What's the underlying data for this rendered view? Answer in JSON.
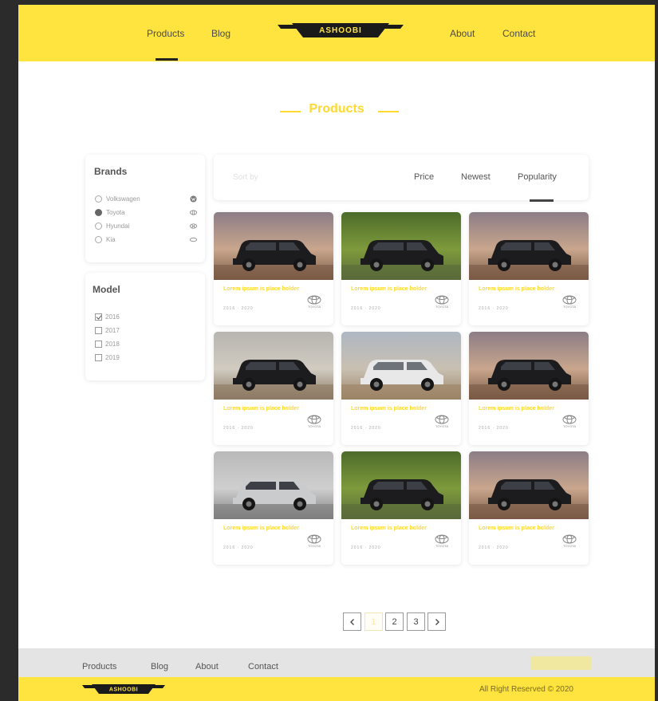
{
  "nav": {
    "left": [
      "Products",
      "Blog"
    ],
    "right": [
      "About",
      "Contact"
    ],
    "logo_text": "ASHOOBI"
  },
  "section_title": "Products",
  "filters": {
    "brands_title": "Brands",
    "brands": [
      {
        "label": "Volkswagen",
        "checked": false,
        "icon": "vw-logo-icon"
      },
      {
        "label": "Toyota",
        "checked": true,
        "icon": "toyota-logo-icon"
      },
      {
        "label": "Hyundai",
        "checked": false,
        "icon": "hyundai-logo-icon"
      },
      {
        "label": "Kia",
        "checked": false,
        "icon": "kia-logo-icon"
      }
    ],
    "model_title": "Model",
    "models": [
      {
        "label": "2016",
        "checked": true
      },
      {
        "label": "2017",
        "checked": false
      },
      {
        "label": "2018",
        "checked": false
      },
      {
        "label": "2019",
        "checked": false
      }
    ]
  },
  "sort": {
    "placeholder": "Sort by",
    "options": [
      "Price",
      "Newest",
      "Popularity"
    ],
    "active": "Popularity"
  },
  "products": [
    {
      "name": "Lorem ipsum is place holder",
      "meta": "2016 · 2020",
      "brand": "TOYOTA",
      "scene": "dusk",
      "car": "black"
    },
    {
      "name": "Lorem ipsum is place holder",
      "meta": "2016 · 2020",
      "brand": "TOYOTA",
      "scene": "forest",
      "car": "black"
    },
    {
      "name": "Lorem ipsum is place holder",
      "meta": "2016 · 2020",
      "brand": "TOYOTA",
      "scene": "dusk",
      "car": "black-rear"
    },
    {
      "name": "Lorem ipsum is place holder",
      "meta": "2016 · 2020",
      "brand": "TOYOTA",
      "scene": "overcast",
      "car": "black"
    },
    {
      "name": "Lorem ipsum is place holder",
      "meta": "2016 · 2020",
      "brand": "TOYOTA",
      "scene": "desert",
      "car": "white"
    },
    {
      "name": "Lorem ipsum is place holder",
      "meta": "2016 · 2020",
      "brand": "TOYOTA",
      "scene": "dusk",
      "car": "black"
    },
    {
      "name": "Lorem ipsum is place holder",
      "meta": "2016 · 2020",
      "brand": "TOYOTA",
      "scene": "road",
      "car": "silver"
    },
    {
      "name": "Lorem ipsum is place holder",
      "meta": "2016 · 2020",
      "brand": "TOYOTA",
      "scene": "forest",
      "car": "black"
    },
    {
      "name": "Lorem ipsum is place holder",
      "meta": "2016 · 2020",
      "brand": "TOYOTA",
      "scene": "dusk",
      "car": "black-rear"
    }
  ],
  "pagination": {
    "prev_icon": "‹",
    "pages": [
      "1",
      "2",
      "3"
    ],
    "active_page": "1",
    "next_icon": "›"
  },
  "footer": {
    "links": [
      "Products",
      "Blog",
      "About",
      "Contact"
    ],
    "logo_text": "ASHOOBI",
    "copyright": "All Right Reserved © 2020"
  },
  "colors": {
    "brand_yellow": "#ffe43f",
    "accent_yellow": "#ffd92e",
    "footer_gray": "#e4e4e4"
  }
}
